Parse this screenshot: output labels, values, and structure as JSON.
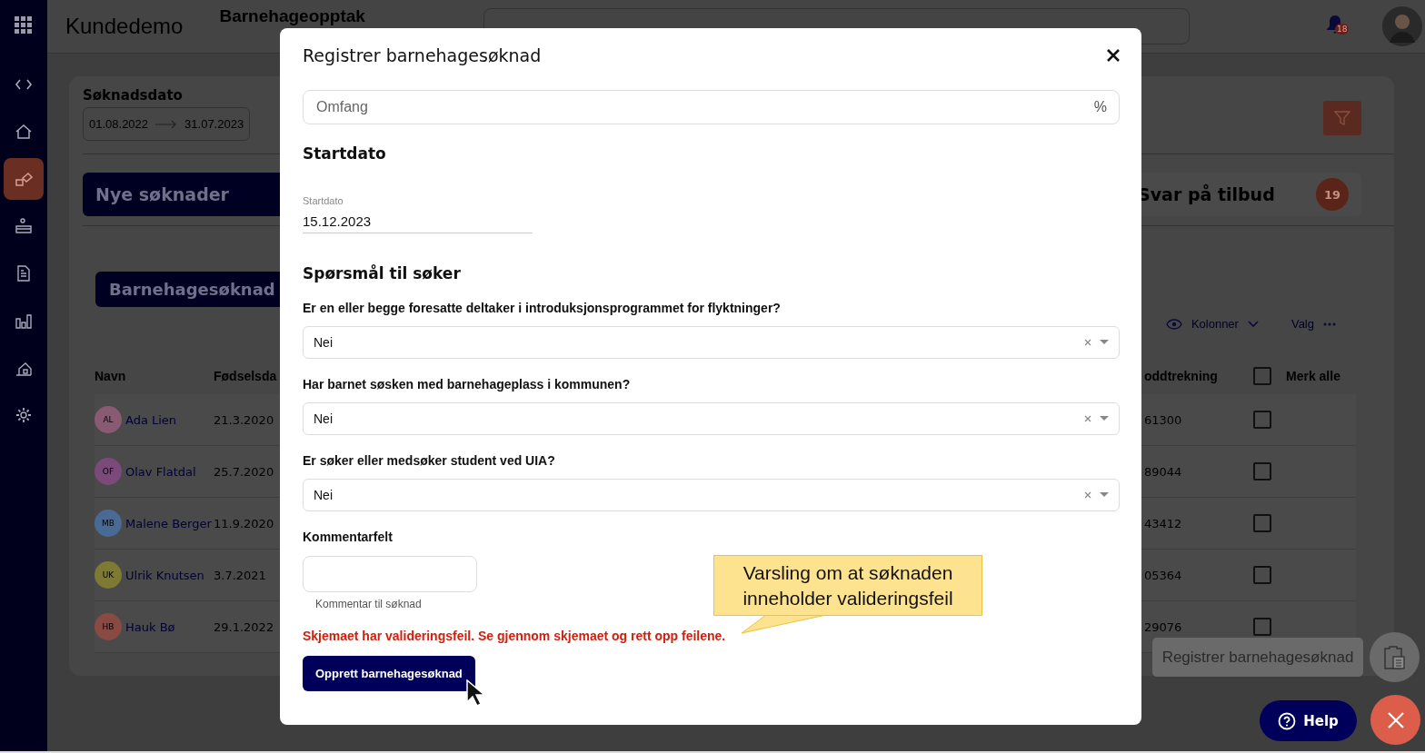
{
  "app": {
    "title": "Kundedemo",
    "section": "Barnehageopptak"
  },
  "notifications": {
    "count": "18"
  },
  "sidebar": {
    "items": [
      {
        "kind": "code",
        "selected": false
      },
      {
        "kind": "home",
        "selected": false
      },
      {
        "kind": "blocks",
        "selected": true
      },
      {
        "kind": "desk",
        "selected": false
      },
      {
        "kind": "document",
        "selected": false
      },
      {
        "kind": "chart",
        "selected": false
      },
      {
        "kind": "house",
        "selected": false
      },
      {
        "kind": "settings",
        "selected": false
      }
    ]
  },
  "filters": {
    "label": "Søknadsdato",
    "from": "01.08.2022",
    "to": "31.07.2023"
  },
  "tabs": [
    {
      "label": "Nye søknader",
      "selected": true
    },
    {
      "label": "Svar på tilbud",
      "count": "19",
      "selected": false
    }
  ],
  "panel": {
    "title": "Barnehagesøknad",
    "toolbar": [
      "Kolonner",
      "Valg"
    ]
  },
  "table": {
    "columns": [
      "Navn",
      "Fødselsda",
      "oddtrekning",
      "Merk alle"
    ],
    "select_all_checked": false,
    "rows": [
      {
        "initials": "AL",
        "color": "#8a5a72",
        "name": "Ada Lien",
        "birth_date": "21.3.2020",
        "column_3": "61300",
        "checked": false
      },
      {
        "initials": "OF",
        "color": "#7a4a7a",
        "name": "Olav Flatdal",
        "birth_date": "25.7.2020",
        "column_3": "89044",
        "checked": false
      },
      {
        "initials": "MB",
        "color": "#4a6a96",
        "name": "Malene Berger",
        "birth_date": "11.9.2020",
        "column_3": "43412",
        "checked": false
      },
      {
        "initials": "UK",
        "color": "#7e7a34",
        "name": "Ulrik Knutsen",
        "birth_date": "3.7.2021",
        "column_3": "05364",
        "checked": false
      },
      {
        "initials": "HB",
        "color": "#8a4a44",
        "name": "Hauk Bø",
        "birth_date": "29.1.2022",
        "column_3": "29076",
        "checked": false
      }
    ]
  },
  "modal": {
    "title": "Registrer barnehagesøknad",
    "scope_field": {
      "placeholder": "Omfang",
      "suffix": "%"
    },
    "start_section": "Startdato",
    "start_field": {
      "label": "Startdato",
      "value": "15.12.2023"
    },
    "questions_section": "Spørsmål til søker",
    "questions": [
      {
        "label": "Er en eller begge foresatte deltaker i introduksjonsprogrammet for flyktninger?",
        "value": "Nei"
      },
      {
        "label": "Har barnet søsken med barnehageplass i kommunen?",
        "value": "Nei"
      },
      {
        "label": "Er søker eller medsøker student ved UIA?",
        "value": "Nei"
      }
    ],
    "comment": {
      "label": "Kommentarfelt",
      "helper": "Kommentar til søknad"
    },
    "error": "Skjemaet har valideringsfeil. Se gjennom skjemaet og rett opp feilene.",
    "submit": "Opprett barnehagesøknad"
  },
  "callout": {
    "lines": [
      "Varsling om at søknaden",
      "inneholder valideringsfeil"
    ]
  },
  "fab": {
    "tooltip": "Registrer barnehagesøknad",
    "help": "Help"
  }
}
